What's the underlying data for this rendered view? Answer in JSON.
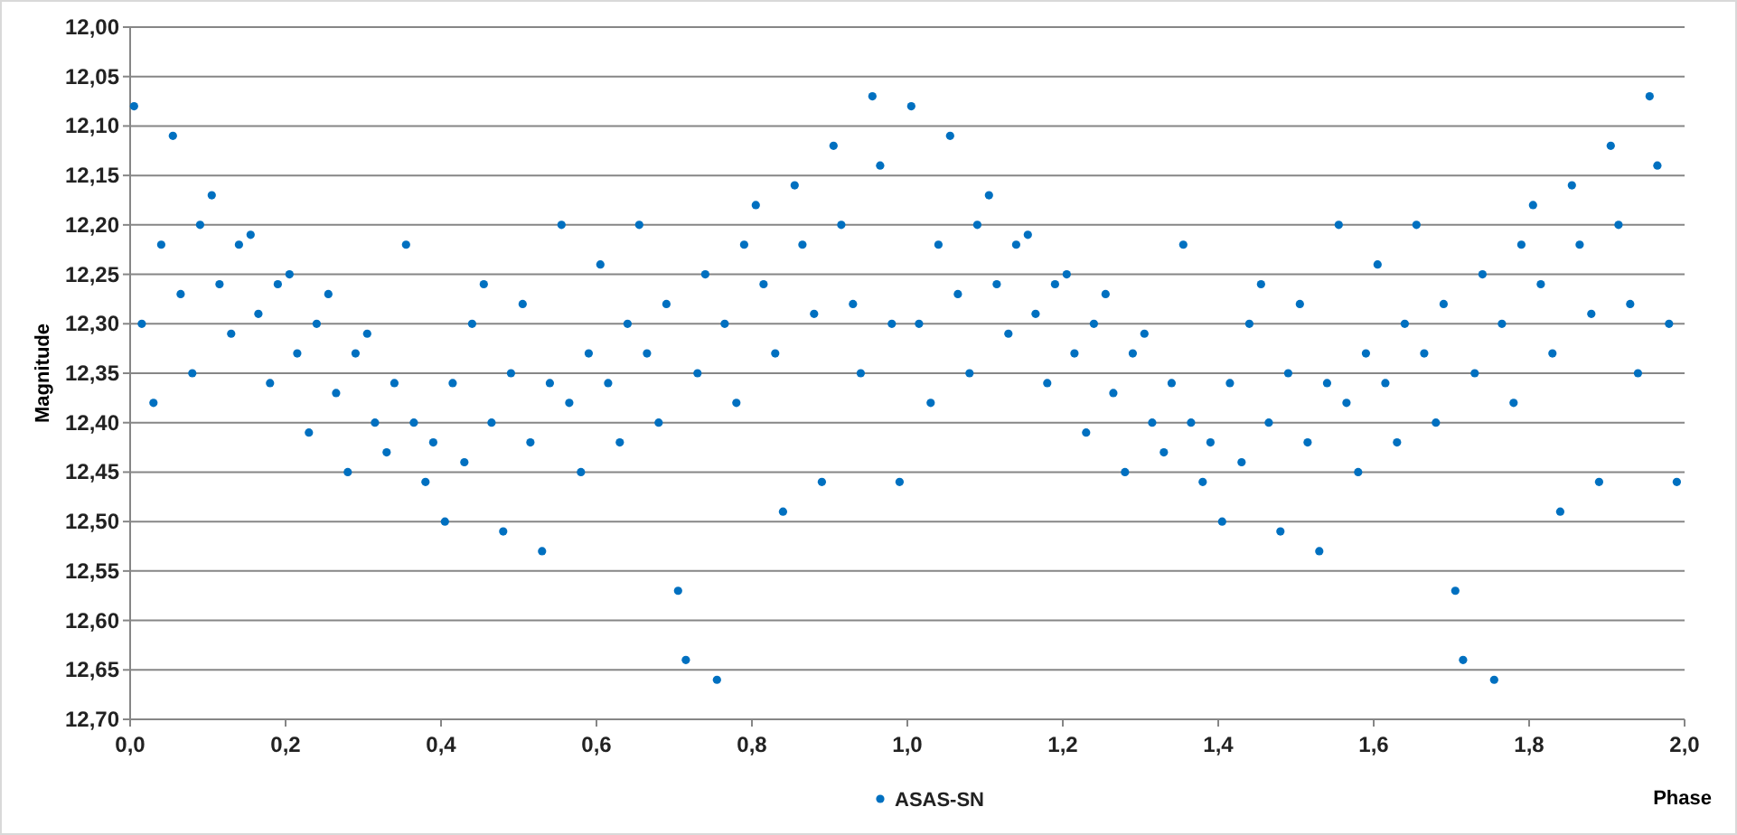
{
  "chart_data": {
    "type": "scatter",
    "grid": {
      "y": true,
      "x": false
    },
    "xlabel": "Phase",
    "ylabel": "Magnitude",
    "xlim": [
      0,
      2
    ],
    "ylim": [
      12.7,
      12.0
    ],
    "xticks": [
      {
        "value": 0,
        "label": "0,0"
      },
      {
        "value": 0.2,
        "label": "0,2"
      },
      {
        "value": 0.4,
        "label": "0,4"
      },
      {
        "value": 0.6,
        "label": "0,6"
      },
      {
        "value": 0.8,
        "label": "0,8"
      },
      {
        "value": 1.0,
        "label": "1,0"
      },
      {
        "value": 1.2,
        "label": "1,2"
      },
      {
        "value": 1.4,
        "label": "1,4"
      },
      {
        "value": 1.6,
        "label": "1,6"
      },
      {
        "value": 1.8,
        "label": "1,8"
      },
      {
        "value": 2.0,
        "label": "2,0"
      }
    ],
    "yticks": [
      {
        "value": 12.0,
        "label": "12,00"
      },
      {
        "value": 12.05,
        "label": "12,05"
      },
      {
        "value": 12.1,
        "label": "12,10"
      },
      {
        "value": 12.15,
        "label": "12,15"
      },
      {
        "value": 12.2,
        "label": "12,20"
      },
      {
        "value": 12.25,
        "label": "12,25"
      },
      {
        "value": 12.3,
        "label": "12,30"
      },
      {
        "value": 12.35,
        "label": "12,35"
      },
      {
        "value": 12.4,
        "label": "12,40"
      },
      {
        "value": 12.45,
        "label": "12,45"
      },
      {
        "value": 12.5,
        "label": "12,50"
      },
      {
        "value": 12.55,
        "label": "12,55"
      },
      {
        "value": 12.6,
        "label": "12,60"
      },
      {
        "value": 12.65,
        "label": "12,65"
      },
      {
        "value": 12.7,
        "label": "12,70"
      }
    ],
    "x": [
      0.005,
      0.015,
      0.03,
      0.04,
      0.055,
      0.065,
      0.08,
      0.09,
      0.105,
      0.115,
      0.13,
      0.14,
      0.155,
      0.165,
      0.18,
      0.19,
      0.205,
      0.215,
      0.23,
      0.24,
      0.255,
      0.265,
      0.28,
      0.29,
      0.305,
      0.315,
      0.33,
      0.34,
      0.355,
      0.365,
      0.38,
      0.39,
      0.405,
      0.415,
      0.43,
      0.44,
      0.455,
      0.465,
      0.48,
      0.49,
      0.505,
      0.515,
      0.53,
      0.54,
      0.555,
      0.565,
      0.58,
      0.59,
      0.605,
      0.615,
      0.63,
      0.64,
      0.655,
      0.665,
      0.68,
      0.69,
      0.705,
      0.715,
      0.73,
      0.74,
      0.755,
      0.765,
      0.78,
      0.79,
      0.805,
      0.815,
      0.83,
      0.84,
      0.855,
      0.865,
      0.88,
      0.89,
      0.905,
      0.915,
      0.93,
      0.94,
      0.955,
      0.965,
      0.98,
      0.99,
      1.005,
      1.015,
      1.03,
      1.04,
      1.055,
      1.065,
      1.08,
      1.09,
      1.105,
      1.115,
      1.13,
      1.14,
      1.155,
      1.165,
      1.18,
      1.19,
      1.205,
      1.215,
      1.23,
      1.24,
      1.255,
      1.265,
      1.28,
      1.29,
      1.305,
      1.315,
      1.33,
      1.34,
      1.355,
      1.365,
      1.38,
      1.39,
      1.405,
      1.415,
      1.43,
      1.44,
      1.455,
      1.465,
      1.48,
      1.49,
      1.505,
      1.515,
      1.53,
      1.54,
      1.555,
      1.565,
      1.58,
      1.59,
      1.605,
      1.615,
      1.63,
      1.64,
      1.655,
      1.665,
      1.68,
      1.69,
      1.705,
      1.715,
      1.73,
      1.74,
      1.755,
      1.765,
      1.78,
      1.79,
      1.805,
      1.815,
      1.83,
      1.84,
      1.855,
      1.865,
      1.88,
      1.89,
      1.905,
      1.915,
      1.93,
      1.94,
      1.955,
      1.965,
      1.98,
      1.99
    ],
    "series": [
      {
        "name": "ASAS-SN",
        "color": "#0070c0",
        "values": [
          12.08,
          12.3,
          12.38,
          12.22,
          12.11,
          12.27,
          12.35,
          12.2,
          12.17,
          12.26,
          12.31,
          12.22,
          12.21,
          12.29,
          12.36,
          12.26,
          12.25,
          12.33,
          12.41,
          12.3,
          12.27,
          12.37,
          12.45,
          12.33,
          12.31,
          12.4,
          12.43,
          12.36,
          12.22,
          12.4,
          12.46,
          12.42,
          12.5,
          12.36,
          12.44,
          12.3,
          12.26,
          12.4,
          12.51,
          12.35,
          12.28,
          12.42,
          12.53,
          12.36,
          12.2,
          12.38,
          12.45,
          12.33,
          12.24,
          12.36,
          12.42,
          12.3,
          12.2,
          12.33,
          12.4,
          12.28,
          12.57,
          12.64,
          12.35,
          12.25,
          12.66,
          12.3,
          12.38,
          12.22,
          12.18,
          12.26,
          12.33,
          12.49,
          12.16,
          12.22,
          12.29,
          12.46,
          12.12,
          12.2,
          12.28,
          12.35,
          12.07,
          12.14,
          12.3,
          12.46,
          12.08,
          12.3,
          12.38,
          12.22,
          12.11,
          12.27,
          12.35,
          12.2,
          12.17,
          12.26,
          12.31,
          12.22,
          12.21,
          12.29,
          12.36,
          12.26,
          12.25,
          12.33,
          12.41,
          12.3,
          12.27,
          12.37,
          12.45,
          12.33,
          12.31,
          12.4,
          12.43,
          12.36,
          12.22,
          12.4,
          12.46,
          12.42,
          12.5,
          12.36,
          12.44,
          12.3,
          12.26,
          12.4,
          12.51,
          12.35,
          12.28,
          12.42,
          12.53,
          12.36,
          12.2,
          12.38,
          12.45,
          12.33,
          12.24,
          12.36,
          12.42,
          12.3,
          12.2,
          12.33,
          12.4,
          12.28,
          12.57,
          12.64,
          12.35,
          12.25,
          12.66,
          12.3,
          12.38,
          12.22,
          12.18,
          12.26,
          12.33,
          12.49,
          12.16,
          12.22,
          12.29,
          12.46,
          12.12,
          12.2,
          12.28,
          12.35,
          12.07,
          12.14,
          12.3,
          12.46
        ]
      }
    ]
  }
}
